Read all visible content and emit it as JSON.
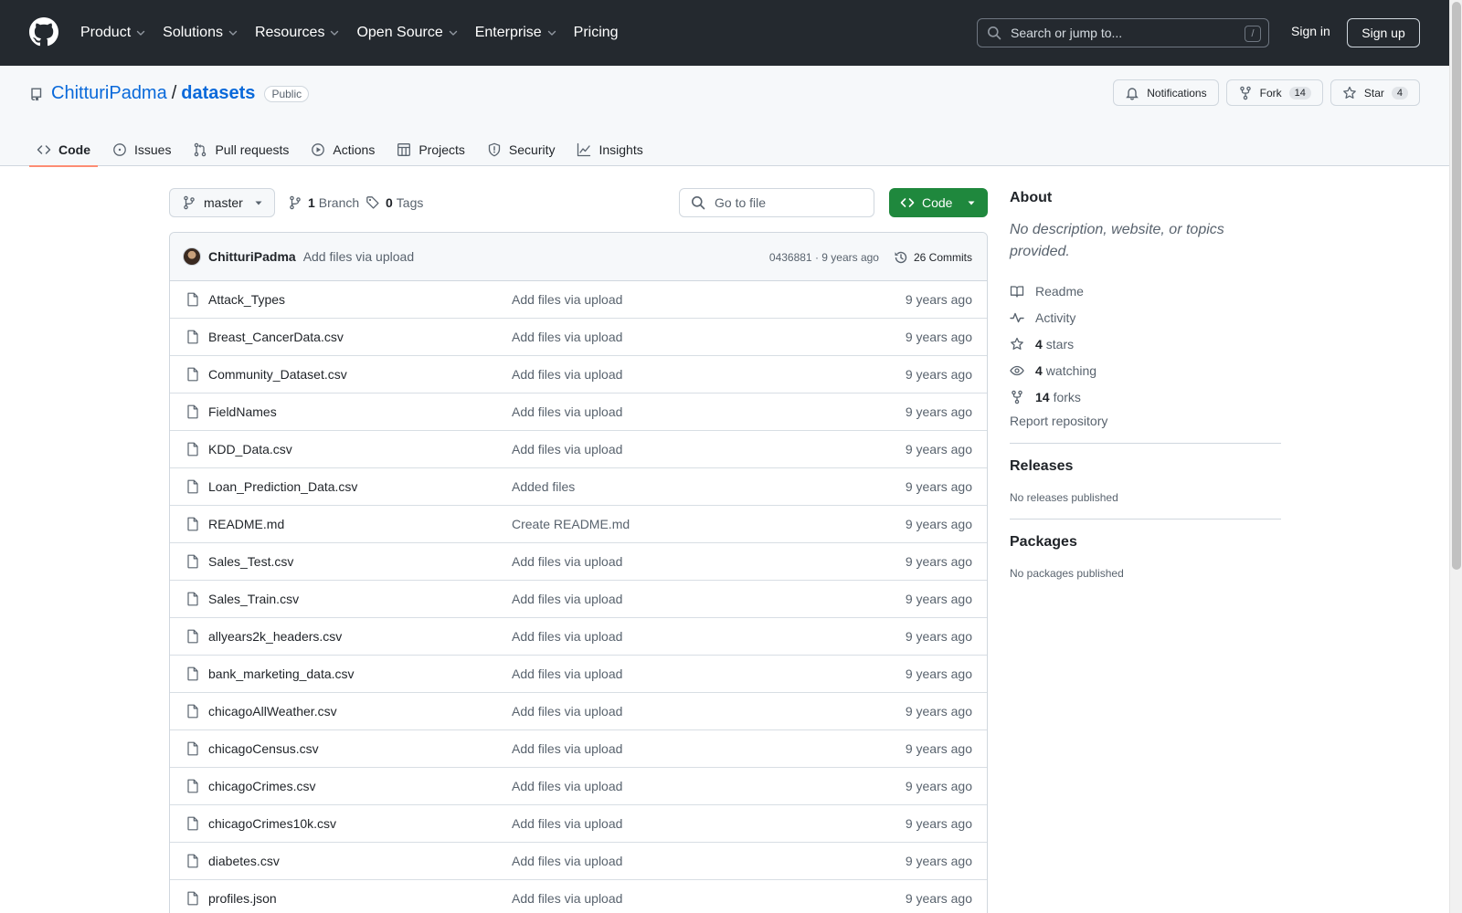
{
  "header": {
    "nav": [
      {
        "label": "Product",
        "has_menu": true
      },
      {
        "label": "Solutions",
        "has_menu": true
      },
      {
        "label": "Resources",
        "has_menu": true
      },
      {
        "label": "Open Source",
        "has_menu": true
      },
      {
        "label": "Enterprise",
        "has_menu": true
      },
      {
        "label": "Pricing",
        "has_menu": false
      }
    ],
    "search_placeholder": "Search or jump to...",
    "search_shortcut": "/",
    "sign_in": "Sign in",
    "sign_up": "Sign up"
  },
  "repo": {
    "owner": "ChitturiPadma",
    "separator": "/",
    "name": "datasets",
    "visibility": "Public",
    "notifications_label": "Notifications",
    "fork_label": "Fork",
    "fork_count": "14",
    "star_label": "Star",
    "star_count": "4"
  },
  "tabs": [
    {
      "label": "Code",
      "icon": "code-icon",
      "active": true
    },
    {
      "label": "Issues",
      "icon": "issue-icon",
      "active": false
    },
    {
      "label": "Pull requests",
      "icon": "pull-request-icon",
      "active": false
    },
    {
      "label": "Actions",
      "icon": "play-icon",
      "active": false
    },
    {
      "label": "Projects",
      "icon": "table-icon",
      "active": false
    },
    {
      "label": "Security",
      "icon": "shield-icon",
      "active": false
    },
    {
      "label": "Insights",
      "icon": "graph-icon",
      "active": false
    }
  ],
  "toolbar": {
    "branch": "master",
    "branch_count": "1",
    "branch_label": "Branch",
    "tag_count": "0",
    "tag_label": "Tags",
    "goto_placeholder": "Go to file",
    "code_label": "Code"
  },
  "commit": {
    "author": "ChitturiPadma",
    "message": "Add files via upload",
    "meta": "0436881 · 9 years ago",
    "commits_label": "26 Commits"
  },
  "files": [
    {
      "name": "Attack_Types",
      "message": "Add files via upload",
      "age": "9 years ago"
    },
    {
      "name": "Breast_CancerData.csv",
      "message": "Add files via upload",
      "age": "9 years ago"
    },
    {
      "name": "Community_Dataset.csv",
      "message": "Add files via upload",
      "age": "9 years ago"
    },
    {
      "name": "FieldNames",
      "message": "Add files via upload",
      "age": "9 years ago"
    },
    {
      "name": "KDD_Data.csv",
      "message": "Add files via upload",
      "age": "9 years ago"
    },
    {
      "name": "Loan_Prediction_Data.csv",
      "message": "Added files",
      "age": "9 years ago"
    },
    {
      "name": "README.md",
      "message": "Create README.md",
      "age": "9 years ago"
    },
    {
      "name": "Sales_Test.csv",
      "message": "Add files via upload",
      "age": "9 years ago"
    },
    {
      "name": "Sales_Train.csv",
      "message": "Add files via upload",
      "age": "9 years ago"
    },
    {
      "name": "allyears2k_headers.csv",
      "message": "Add files via upload",
      "age": "9 years ago"
    },
    {
      "name": "bank_marketing_data.csv",
      "message": "Add files via upload",
      "age": "9 years ago"
    },
    {
      "name": "chicagoAllWeather.csv",
      "message": "Add files via upload",
      "age": "9 years ago"
    },
    {
      "name": "chicagoCensus.csv",
      "message": "Add files via upload",
      "age": "9 years ago"
    },
    {
      "name": "chicagoCrimes.csv",
      "message": "Add files via upload",
      "age": "9 years ago"
    },
    {
      "name": "chicagoCrimes10k.csv",
      "message": "Add files via upload",
      "age": "9 years ago"
    },
    {
      "name": "diabetes.csv",
      "message": "Add files via upload",
      "age": "9 years ago"
    },
    {
      "name": "profiles.json",
      "message": "Add files via upload",
      "age": "9 years ago"
    }
  ],
  "sidebar": {
    "about_title": "About",
    "description": "No description, website, or topics provided.",
    "readme": "Readme",
    "activity": "Activity",
    "stars_count": "4",
    "stars_label": "stars",
    "watching_count": "4",
    "watching_label": "watching",
    "forks_count": "14",
    "forks_label": "forks",
    "report": "Report repository",
    "releases_title": "Releases",
    "releases_empty": "No releases published",
    "packages_title": "Packages",
    "packages_empty": "No packages published"
  },
  "colors": {
    "header_bg": "#24292f",
    "link": "#0969da",
    "code_button": "#1f883d",
    "active_tab_underline": "#fd8c73"
  }
}
